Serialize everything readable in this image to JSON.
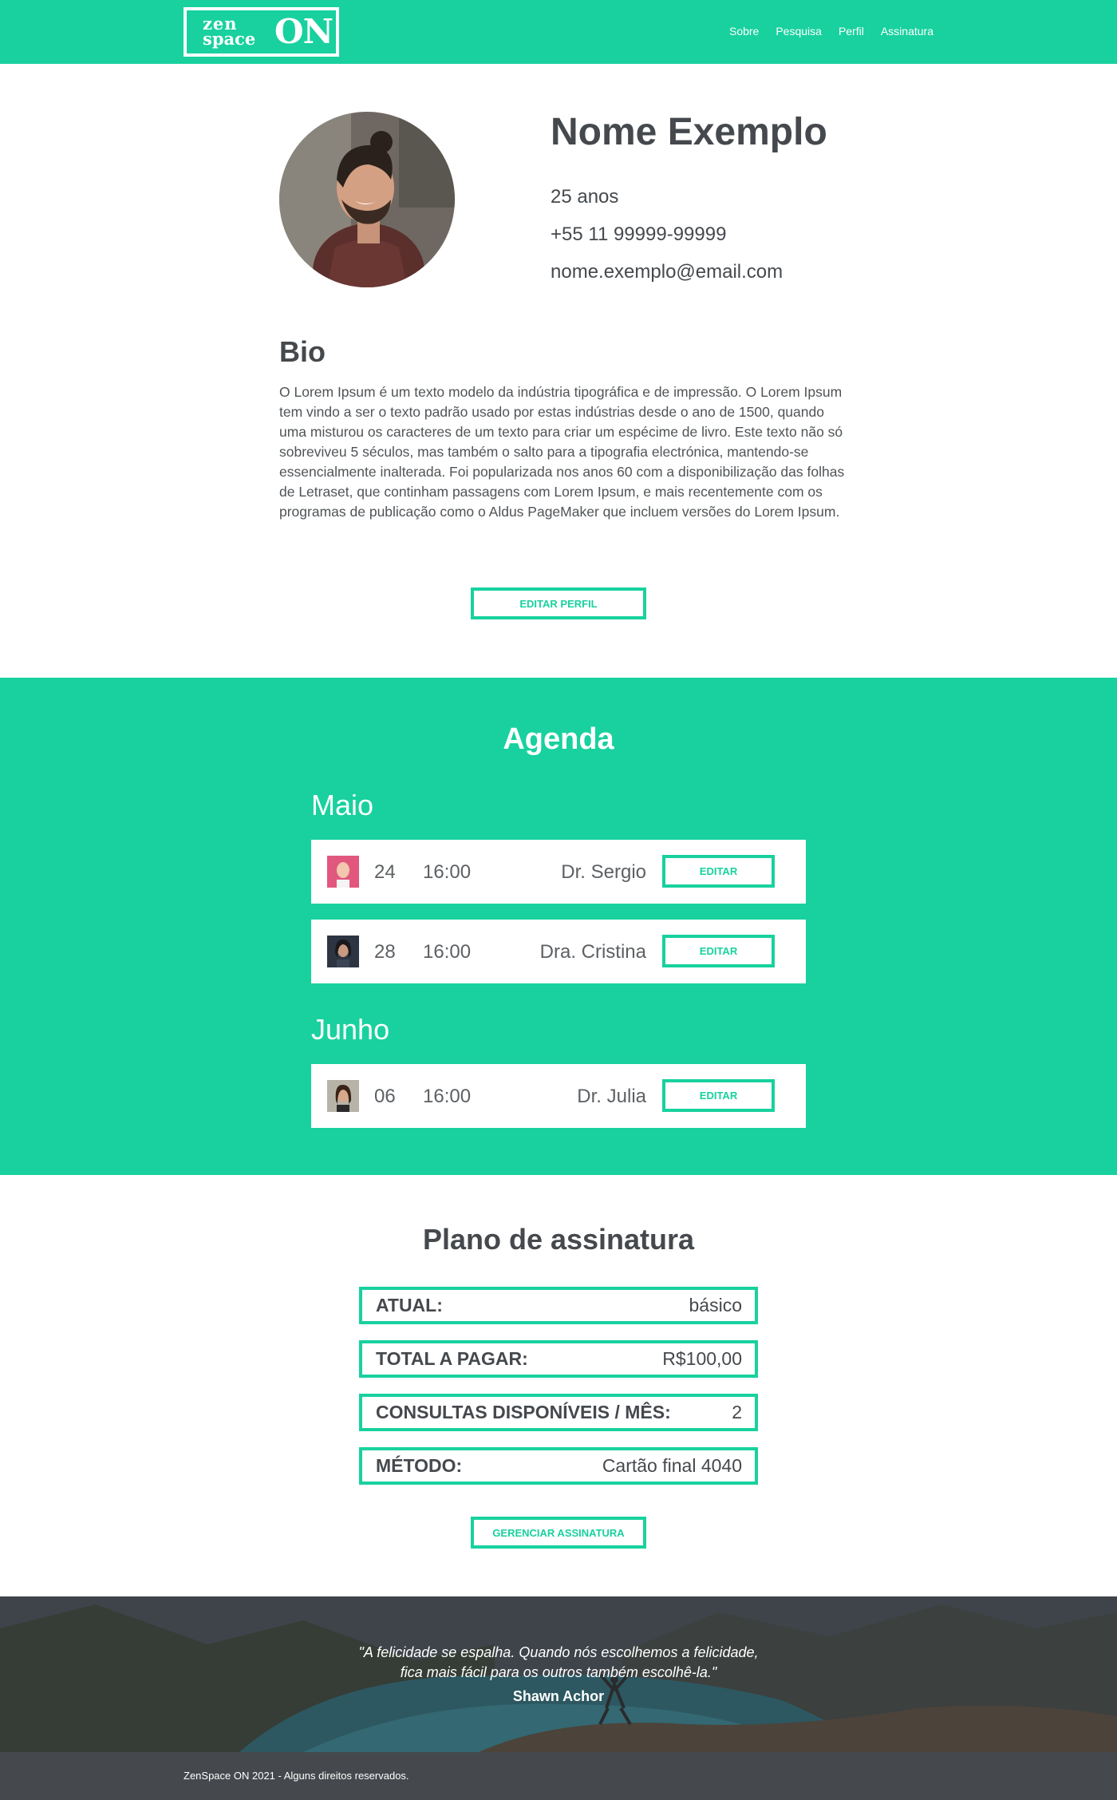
{
  "brand": {
    "logo_line1": "zen",
    "logo_line2": "space",
    "logo_on": "ON"
  },
  "nav": {
    "items": [
      "Sobre",
      "Pesquisa",
      "Perfil",
      "Assinatura"
    ]
  },
  "colors": {
    "accent": "#18d19e",
    "text_dark": "#45494d",
    "footer_bg": "#45494d"
  },
  "profile": {
    "name": "Nome Exemplo",
    "age": "25 anos",
    "phone": "+55 11 99999-99999",
    "email": "nome.exemplo@email.com",
    "bio_title": "Bio",
    "bio": "O Lorem Ipsum é um texto modelo da indústria tipográfica e de impressão. O Lorem Ipsum tem vindo a ser o texto padrão usado por estas indústrias desde o ano de 1500, quando uma misturou os caracteres de um texto para criar um espécime de livro. Este texto não só sobreviveu 5 séculos, mas também o salto para a tipografia electrónica, mantendo-se essencialmente inalterada. Foi popularizada nos anos 60 com a disponibilização das folhas de Letraset, que continham passagens com Lorem Ipsum, e mais recentemente com os programas de publicação como o Aldus PageMaker que incluem versões do Lorem Ipsum.",
    "edit_button": "EDITAR PERFIL"
  },
  "agenda": {
    "title": "Agenda",
    "months": [
      {
        "name": "Maio",
        "appointments": [
          {
            "day": "24",
            "time": "16:00",
            "doctor": "Dr. Sergio",
            "button": "EDITAR"
          },
          {
            "day": "28",
            "time": "16:00",
            "doctor": "Dra. Cristina",
            "button": "EDITAR"
          }
        ]
      },
      {
        "name": "Junho",
        "appointments": [
          {
            "day": "06",
            "time": "16:00",
            "doctor": "Dr. Julia",
            "button": "EDITAR"
          }
        ]
      }
    ]
  },
  "plan": {
    "title": "Plano de assinatura",
    "rows": [
      {
        "label": "ATUAL:",
        "value": "básico"
      },
      {
        "label": "TOTAL A PAGAR:",
        "value": "R$100,00"
      },
      {
        "label": "CONSULTAS DISPONÍVEIS / MÊS:",
        "value": "2"
      },
      {
        "label": "MÉTODO:",
        "value": "Cartão final 4040"
      }
    ],
    "manage_button": "GERENCIAR ASSINATURA"
  },
  "quote": {
    "line1": "\"A felicidade se espalha. Quando nós escolhemos a felicidade,",
    "line2": "fica mais fácil para os outros também escolhê-la.\"",
    "author": "Shawn Achor"
  },
  "footer": {
    "text": "ZenSpace ON 2021 - Alguns direitos reservados."
  }
}
